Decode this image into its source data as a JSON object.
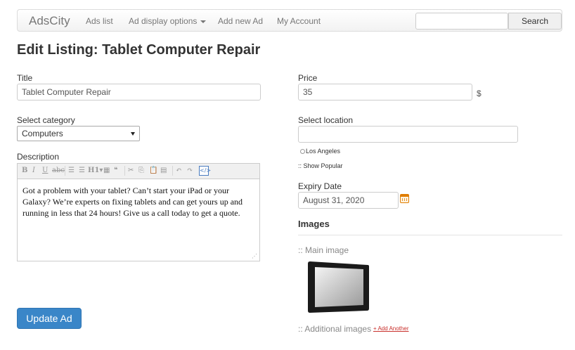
{
  "navbar": {
    "brand": "AdsCity",
    "items": [
      "Ads list",
      "Ad display options",
      "Add new Ad",
      "My Account"
    ],
    "search_value": "",
    "search_button": "Search"
  },
  "page_title": "Edit Listing: Tablet Computer Repair",
  "form": {
    "title_label": "Title",
    "title_value": "Tablet Computer Repair",
    "category_label": "Select category",
    "category_value": "Computers",
    "description_label": "Description",
    "description_text": "Got a problem with your tablet? Can’t start your iPad or your Galaxy? We’re experts on fixing tablets and can get yours up and running in less that 24 hours! Give us a call today to get a quote.",
    "price_label": "Price",
    "price_value": "35",
    "currency": "$",
    "location_label": "Select location",
    "location_value": "",
    "location_option": "Los Angeles",
    "show_popular": ":: Show Popular",
    "expiry_label": "Expiry Date",
    "expiry_value": "August 31, 2020",
    "images_heading": "Images",
    "main_image_label": ":: Main image",
    "additional_images_label": ":: Additional images",
    "add_another": "+ Add Another",
    "submit": "Update Ad"
  },
  "editor_toolbar": [
    "bold-icon",
    "italic-icon",
    "underline-icon",
    "strikethrough-icon",
    "bullet-list-icon",
    "numbered-list-icon",
    "heading-icon",
    "table-icon",
    "quote-icon",
    "cut-icon",
    "copy-icon",
    "paste-icon",
    "paste-text-icon",
    "undo-icon",
    "redo-icon",
    "source-icon"
  ],
  "colors": {
    "primary": "#3a86c8",
    "link_red": "#c9302c",
    "calendar_orange": "#e07d00"
  }
}
